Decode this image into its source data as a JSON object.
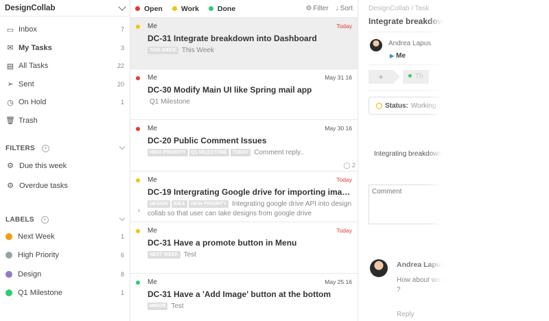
{
  "sidebar": {
    "app_name": "DesignCollab",
    "nav": [
      {
        "icon": "inbox-icon",
        "glyph": "▭",
        "label": "Inbox",
        "count": "7",
        "active": false
      },
      {
        "icon": "mail-icon",
        "glyph": "✉",
        "label": "My Tasks",
        "count": "3",
        "active": true
      },
      {
        "icon": "archive-icon",
        "glyph": "▤",
        "label": "All Tasks",
        "count": "22",
        "active": false
      },
      {
        "icon": "send-icon",
        "glyph": "➢",
        "label": "Sent",
        "count": "20",
        "active": false
      },
      {
        "icon": "clock-icon",
        "glyph": "◷",
        "label": "On Hold",
        "count": "1",
        "active": false
      },
      {
        "icon": "trash-icon",
        "glyph": "🗑",
        "label": "Trash",
        "count": "",
        "active": false
      }
    ],
    "filters_heading": "FILTERS",
    "filters": [
      {
        "label": "Due this week"
      },
      {
        "label": "Overdue tasks"
      }
    ],
    "labels_heading": "LABELS",
    "labels": [
      {
        "label": "Next Week",
        "count": "1",
        "color": "#f39c12"
      },
      {
        "label": "High Priority",
        "count": "6",
        "color": "#95a5a6"
      },
      {
        "label": "Design",
        "count": "8",
        "color": "#8e7cc3"
      },
      {
        "label": "Q1 Milestone",
        "count": "1",
        "color": "#2ecc71"
      }
    ]
  },
  "list": {
    "legend": [
      {
        "label": "Open",
        "color": "#e53935"
      },
      {
        "label": "Work",
        "color": "#f1c40f"
      },
      {
        "label": "Done",
        "color": "#2ecc71"
      }
    ],
    "filter_label": "Filter",
    "sort_label": "Sort",
    "tasks": [
      {
        "assignee": "Me",
        "date": "Today",
        "today": true,
        "status_color": "#f1c40f",
        "title": "DC-31 Integrate breakdown into Dashboard",
        "tags": [
          "THIS WEEK"
        ],
        "text": "This Week",
        "selected": true
      },
      {
        "assignee": "Me",
        "date": "May 31 16",
        "today": false,
        "status_color": "#e53935",
        "title": "DC-30 Modify Main UI like Spring mail app",
        "tags": [],
        "text": "Q1 Milestone",
        "selected": false
      },
      {
        "assignee": "Me",
        "date": "May 30 16",
        "today": false,
        "status_color": "#e53935",
        "title": "DC-20 Public Comment Issues",
        "tags": [
          "HIGH PRIORITY",
          "Q1 MILESTONE",
          "TODAY"
        ],
        "text": "Comment reply..",
        "comments": "2",
        "selected": false
      },
      {
        "assignee": "Me",
        "date": "Today",
        "today": true,
        "status_color": "#f1c40f",
        "title": "DC-19   Intergrating Google drive for importing imag...",
        "tags": [
          "DESIGN",
          "IDEA",
          "HIGH PRIORITY"
        ],
        "text": "Integrating google drive API into design collab so that user can take designs from google drive",
        "bulb": true,
        "selected": false
      },
      {
        "assignee": "Me",
        "date": "Today",
        "today": true,
        "status_color": "#f1c40f",
        "title": "DC-31 Have a promote button in Menu",
        "tags": [
          "NEXT WEEK"
        ],
        "text": "Test",
        "selected": false
      },
      {
        "assignee": "Me",
        "date": "May 25 16",
        "today": false,
        "status_color": "#2ecc71",
        "title": "DC-31 Have a 'Add Image' button at the bottom",
        "tags": [
          "MINOR"
        ],
        "text": "Test",
        "selected": false
      }
    ]
  },
  "detail": {
    "breadcrumb": "DesignCollab / Task",
    "title": "Integrate breakdow",
    "assignee_name": "Andrea Lapus",
    "assignee_me": "Me",
    "plus_label": "+",
    "stage_label": "Th",
    "status_key": "Status:",
    "status_value": "Working",
    "description": "Integrating breakdown",
    "comment_placeholder": "Comment",
    "comment_author": "Andrea Lapus",
    "comment_text": "How about work ?",
    "reply_label": "Reply"
  }
}
